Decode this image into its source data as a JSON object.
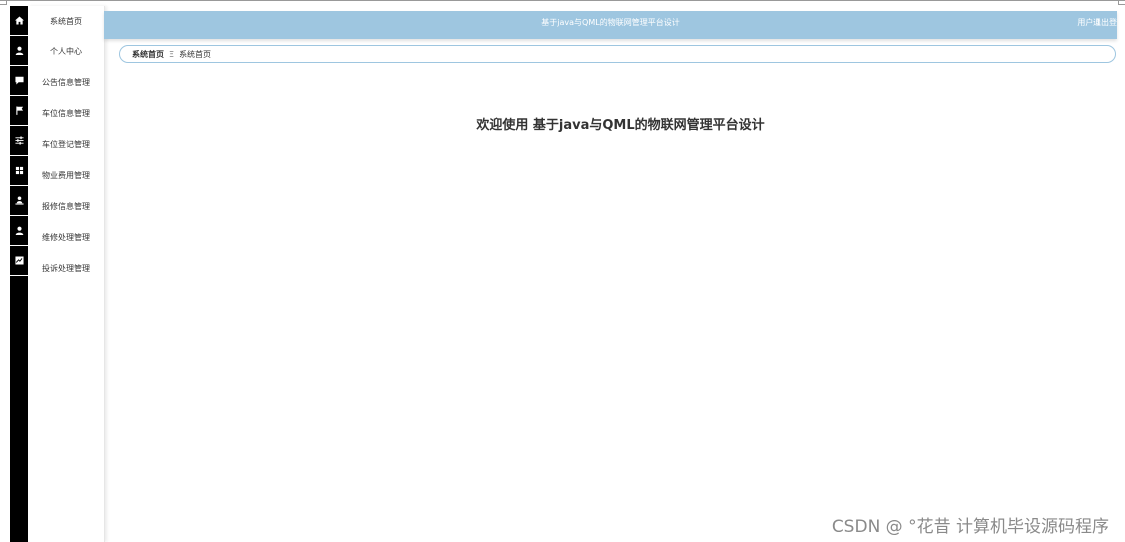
{
  "header": {
    "title": "基于java与QML的物联网管理平台设计",
    "user": "用户 1",
    "logout": "退出登录"
  },
  "sidebar": {
    "items": [
      {
        "label": "系统首页",
        "icon": "home-icon"
      },
      {
        "label": "个人中心",
        "icon": "person-icon"
      },
      {
        "label": "公告信息管理",
        "icon": "chat-icon"
      },
      {
        "label": "车位信息管理",
        "icon": "flag-icon"
      },
      {
        "label": "车位登记管理",
        "icon": "sliders-icon"
      },
      {
        "label": "物业费用管理",
        "icon": "grid-icon"
      },
      {
        "label": "报修信息管理",
        "icon": "person-desk-icon"
      },
      {
        "label": "维修处理管理",
        "icon": "person-icon"
      },
      {
        "label": "投诉处理管理",
        "icon": "chart-icon"
      }
    ]
  },
  "breadcrumb": {
    "home": "系统首页",
    "separator": "Ξ",
    "current": "系统首页"
  },
  "main": {
    "welcome": "欢迎使用 基于java与QML的物联网管理平台设计"
  },
  "watermark": "CSDN @ °花昔  计算机毕设源码程序",
  "colors": {
    "header_bg": "#9ec6e0",
    "rail_bg": "#000000"
  }
}
